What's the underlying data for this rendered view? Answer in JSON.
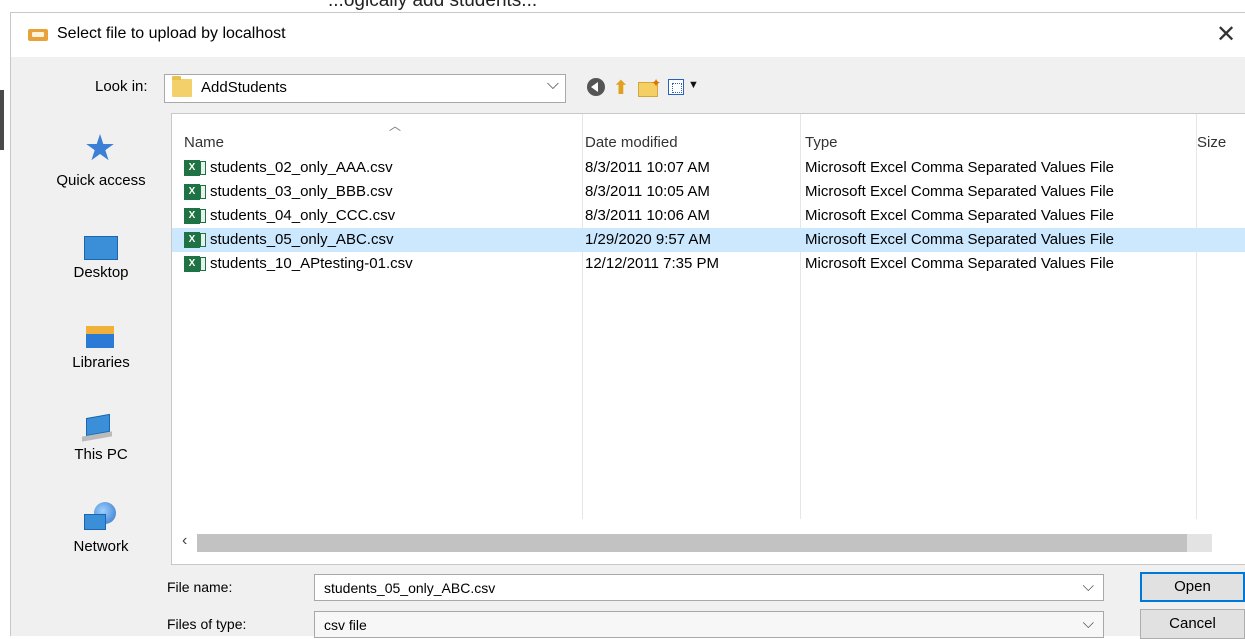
{
  "page_fragment": "...ogically add students...",
  "dialog": {
    "title": "Select file to upload by localhost",
    "close_label": "✕"
  },
  "look_in": {
    "label": "Look in:",
    "value": "AddStudents"
  },
  "toolbar": {
    "back_icon": "back-icon",
    "up_icon": "up-folder-icon",
    "new_folder_icon": "new-folder-icon",
    "view_icon": "view-menu-icon"
  },
  "places": [
    {
      "label": "Quick access",
      "icon": "quick-access-icon"
    },
    {
      "label": "Desktop",
      "icon": "desktop-icon"
    },
    {
      "label": "Libraries",
      "icon": "libraries-icon"
    },
    {
      "label": "This PC",
      "icon": "this-pc-icon"
    },
    {
      "label": "Network",
      "icon": "network-icon"
    }
  ],
  "columns": {
    "name": "Name",
    "date": "Date modified",
    "type": "Type",
    "size": "Size"
  },
  "files": [
    {
      "name": "students_02_only_AAA.csv",
      "date": "8/3/2011 10:07 AM",
      "type": "Microsoft Excel Comma Separated Values File",
      "selected": false
    },
    {
      "name": "students_03_only_BBB.csv",
      "date": "8/3/2011 10:05 AM",
      "type": "Microsoft Excel Comma Separated Values File",
      "selected": false
    },
    {
      "name": "students_04_only_CCC.csv",
      "date": "8/3/2011 10:06 AM",
      "type": "Microsoft Excel Comma Separated Values File",
      "selected": false
    },
    {
      "name": "students_05_only_ABC.csv",
      "date": "1/29/2020 9:57 AM",
      "type": "Microsoft Excel Comma Separated Values File",
      "selected": true
    },
    {
      "name": "students_10_APtesting-01.csv",
      "date": "12/12/2011 7:35 PM",
      "type": "Microsoft Excel Comma Separated Values File",
      "selected": false
    }
  ],
  "file_name": {
    "label": "File name:",
    "value": "students_05_only_ABC.csv"
  },
  "file_type": {
    "label": "Files of type:",
    "value": "csv file"
  },
  "buttons": {
    "open": "Open",
    "cancel": "Cancel"
  },
  "colors": {
    "selection": "#cce8ff",
    "accent": "#0078d7",
    "excel_green": "#1f7244"
  }
}
